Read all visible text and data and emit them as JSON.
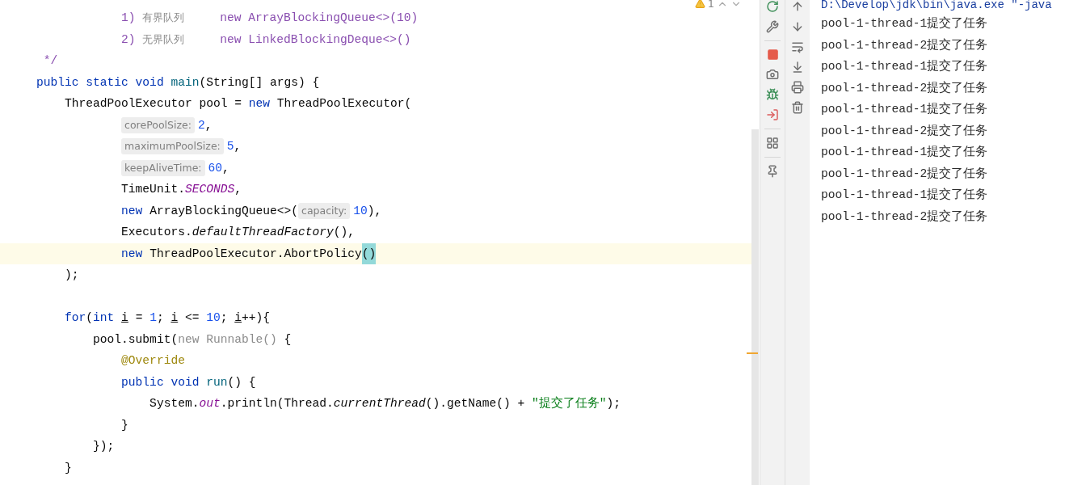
{
  "editor": {
    "inspection": {
      "count": "1"
    },
    "lines": [
      {
        "current": false,
        "tokens": [
          {
            "text": "            1) ",
            "kind": "doc"
          },
          {
            "text": "有界队列",
            "kind": "comment"
          },
          {
            "text": "     new ArrayBlockingQueue<>(10)",
            "kind": "doc"
          }
        ]
      },
      {
        "current": false,
        "tokens": [
          {
            "text": "            2) ",
            "kind": "doc"
          },
          {
            "text": "无界队列",
            "kind": "comment"
          },
          {
            "text": "     new LinkedBlockingDeque<>()",
            "kind": "doc"
          }
        ]
      },
      {
        "current": false,
        "tokens": [
          {
            "text": " */",
            "kind": "doc"
          }
        ]
      },
      {
        "current": false,
        "tokens": [
          {
            "text": "public static void ",
            "kind": "keyword"
          },
          {
            "text": "main",
            "kind": "method"
          },
          {
            "text": "(String[] args) {",
            "kind": "plain"
          }
        ]
      },
      {
        "current": false,
        "tokens": [
          {
            "text": "    ThreadPoolExecutor pool = ",
            "kind": "plain"
          },
          {
            "text": "new ",
            "kind": "keyword"
          },
          {
            "text": "ThreadPoolExecutor(",
            "kind": "plain"
          }
        ]
      },
      {
        "current": false,
        "kind": "argument",
        "tokens": [
          {
            "text": "corePoolSize:",
            "kind": "hint"
          },
          {
            "text": "2",
            "kind": "number"
          },
          {
            "text": ",",
            "kind": "plain"
          }
        ]
      },
      {
        "current": false,
        "kind": "argument",
        "tokens": [
          {
            "text": "maximumPoolSize:",
            "kind": "hint"
          },
          {
            "text": "5",
            "kind": "number"
          },
          {
            "text": ",",
            "kind": "plain"
          }
        ]
      },
      {
        "current": false,
        "kind": "argument",
        "tokens": [
          {
            "text": "keepAliveTime:",
            "kind": "hint"
          },
          {
            "text": "60",
            "kind": "number"
          },
          {
            "text": ",",
            "kind": "plain"
          }
        ]
      },
      {
        "current": false,
        "tokens": [
          {
            "text": "            TimeUnit.",
            "kind": "plain"
          },
          {
            "text": "SECONDS",
            "kind": "static"
          },
          {
            "text": ",",
            "kind": "plain"
          }
        ]
      },
      {
        "current": false,
        "tokens": [
          {
            "text": "            new ",
            "kind": "keyword"
          },
          {
            "text": "ArrayBlockingQueue<>(",
            "kind": "plain"
          },
          {
            "text": "capacity:",
            "kind": "hint"
          },
          {
            "text": "10",
            "kind": "number"
          },
          {
            "text": "),",
            "kind": "plain"
          }
        ]
      },
      {
        "current": false,
        "tokens": [
          {
            "text": "            Executors.",
            "kind": "plain"
          },
          {
            "text": "defaultThreadFactory",
            "kind": "italic"
          },
          {
            "text": "(),",
            "kind": "plain"
          }
        ]
      },
      {
        "current": true,
        "tokens": [
          {
            "text": "            new ",
            "kind": "keyword"
          },
          {
            "text": "ThreadPoolExecutor.AbortPolicy",
            "kind": "plain"
          },
          {
            "text": "()",
            "kind": "brace"
          }
        ]
      },
      {
        "current": false,
        "tokens": [
          {
            "text": "    );",
            "kind": "plain"
          }
        ]
      },
      {
        "current": false
      },
      {
        "current": false,
        "tokens": [
          {
            "text": "    for",
            "kind": "keyword"
          },
          {
            "text": "(",
            "kind": "plain"
          },
          {
            "text": "int ",
            "kind": "keyword"
          },
          {
            "text": "i",
            "kind": "underlined"
          },
          {
            "text": " = ",
            "kind": "plain"
          },
          {
            "text": "1",
            "kind": "number"
          },
          {
            "text": "; ",
            "kind": "plain"
          },
          {
            "text": "i",
            "kind": "underlined"
          },
          {
            "text": " <= ",
            "kind": "plain"
          },
          {
            "text": "10",
            "kind": "number"
          },
          {
            "text": "; ",
            "kind": "plain"
          },
          {
            "text": "i",
            "kind": "underlined"
          },
          {
            "text": "++){",
            "kind": "plain"
          }
        ]
      },
      {
        "current": false,
        "tokens": [
          {
            "text": "        pool.submit(",
            "kind": "plain"
          },
          {
            "text": "new Runnable()",
            "kind": "grey"
          },
          {
            "text": " {",
            "kind": "plain"
          }
        ]
      },
      {
        "current": false,
        "tokens": [
          {
            "text": "            @Override",
            "kind": "annotation"
          }
        ]
      },
      {
        "current": false,
        "tokens": [
          {
            "text": "            public void ",
            "kind": "keyword"
          },
          {
            "text": "run",
            "kind": "method"
          },
          {
            "text": "() {",
            "kind": "plain"
          }
        ]
      },
      {
        "current": false,
        "tokens": [
          {
            "text": "                System.",
            "kind": "plain"
          },
          {
            "text": "out",
            "kind": "static"
          },
          {
            "text": ".println(Thread.",
            "kind": "plain"
          },
          {
            "text": "currentThread",
            "kind": "italic"
          },
          {
            "text": "().getName() + ",
            "kind": "plain"
          },
          {
            "text": "\"提交了任务\"",
            "kind": "string"
          },
          {
            "text": ");",
            "kind": "plain"
          }
        ]
      },
      {
        "current": false,
        "tokens": [
          {
            "text": "            }",
            "kind": "plain"
          }
        ]
      },
      {
        "current": false,
        "tokens": [
          {
            "text": "        });",
            "kind": "plain"
          }
        ]
      },
      {
        "current": false,
        "tokens": [
          {
            "text": "    }",
            "kind": "plain"
          }
        ]
      }
    ]
  },
  "console": {
    "lines": [
      "D:\\Develop\\jdk\\bin\\java.exe \"-java",
      "pool-1-thread-1提交了任务",
      "pool-1-thread-2提交了任务",
      "pool-1-thread-1提交了任务",
      "pool-1-thread-2提交了任务",
      "pool-1-thread-1提交了任务",
      "pool-1-thread-2提交了任务",
      "pool-1-thread-1提交了任务",
      "pool-1-thread-2提交了任务",
      "pool-1-thread-1提交了任务",
      "pool-1-thread-2提交了任务"
    ]
  }
}
